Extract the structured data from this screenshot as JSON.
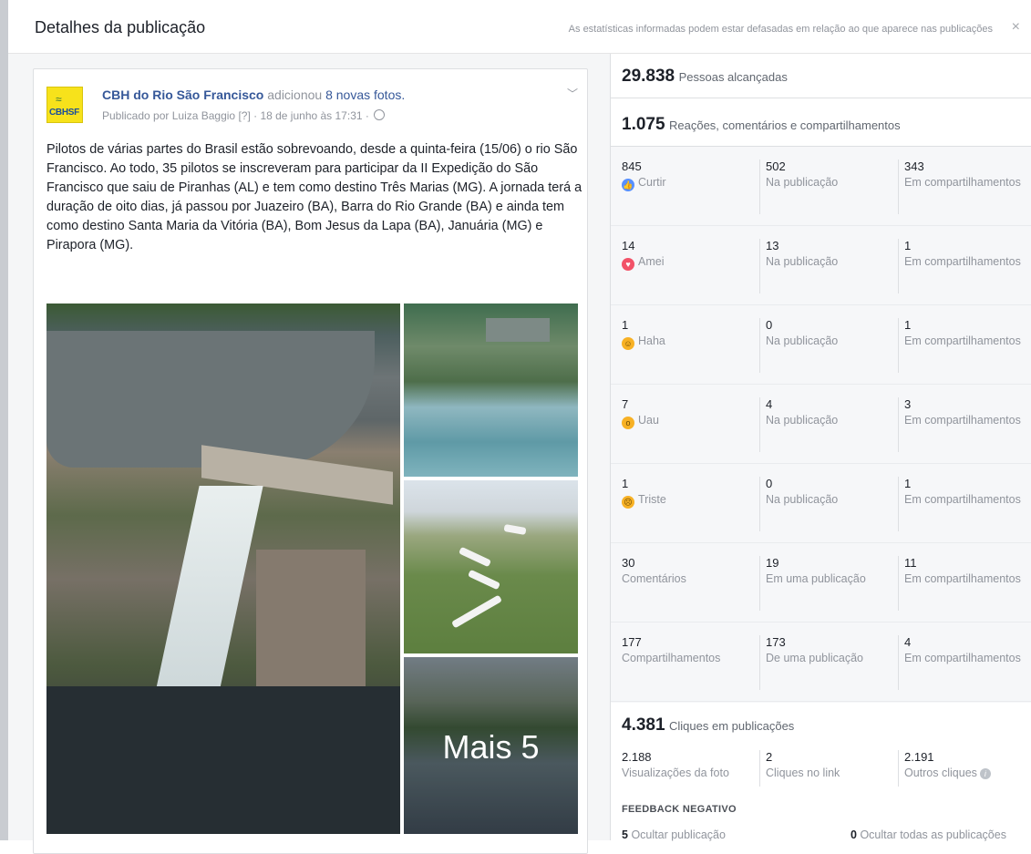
{
  "header": {
    "title": "Detalhes da publicação",
    "notice": "As estatísticas informadas podem estar defasadas em relação ao que aparece nas publicações",
    "close": "×"
  },
  "post": {
    "logo_text": "CBHSF",
    "page_name": "CBH do Rio São Francisco",
    "action": "adicionou",
    "new_photos": "8 novas fotos.",
    "meta": "Publicado por Luiza Baggio [?] · 18 de junho às 17:31 ·",
    "text": "Pilotos de várias partes do Brasil estão sobrevoando, desde a quinta-feira (15/06) o rio São Francisco. Ao todo, 35 pilotos se inscreveram para participar da II Expedição do São Francisco que saiu de Piranhas (AL) e tem como destino Três Marias (MG). A jornada terá a duração de oito dias, já passou por Juazeiro (BA), Barra do Rio Grande (BA) e ainda tem como destino Santa Maria da Vitória (BA), Bom Jesus da Lapa (BA), Januária (MG) e Pirapora (MG).",
    "more_photos": "Mais 5"
  },
  "stats": {
    "reach": {
      "value": "29.838",
      "label": "Pessoas alcançadas"
    },
    "engagement": {
      "value": "1.075",
      "label": "Reações, comentários e compartilhamentos"
    },
    "rows": [
      {
        "total": "845",
        "label": "Curtir",
        "icon": "like-icon",
        "on_post": "502",
        "on_post_label": "Na publicação",
        "shares": "343",
        "shares_label": "Em compartilhamentos"
      },
      {
        "total": "14",
        "label": "Amei",
        "icon": "love-icon",
        "on_post": "13",
        "on_post_label": "Na publicação",
        "shares": "1",
        "shares_label": "Em compartilhamentos"
      },
      {
        "total": "1",
        "label": "Haha",
        "icon": "haha-icon",
        "on_post": "0",
        "on_post_label": "Na publicação",
        "shares": "1",
        "shares_label": "Em compartilhamentos"
      },
      {
        "total": "7",
        "label": "Uau",
        "icon": "wow-icon",
        "on_post": "4",
        "on_post_label": "Na publicação",
        "shares": "3",
        "shares_label": "Em compartilhamentos"
      },
      {
        "total": "1",
        "label": "Triste",
        "icon": "sad-icon",
        "on_post": "0",
        "on_post_label": "Na publicação",
        "shares": "1",
        "shares_label": "Em compartilhamentos"
      },
      {
        "total": "30",
        "label": "Comentários",
        "icon": "",
        "on_post": "19",
        "on_post_label": "Em uma publicação",
        "shares": "11",
        "shares_label": "Em compartilhamentos"
      },
      {
        "total": "177",
        "label": "Compartilhamentos",
        "icon": "",
        "on_post": "173",
        "on_post_label": "De uma publicação",
        "shares": "4",
        "shares_label": "Em compartilhamentos"
      }
    ],
    "clicks": {
      "value": "4.381",
      "label": "Cliques em publicações",
      "photo_views": "2.188",
      "photo_views_label": "Visualizações da foto",
      "link_clicks": "2",
      "link_clicks_label": "Cliques no link",
      "other_clicks": "2.191",
      "other_clicks_label": "Outros cliques"
    },
    "negative_feedback": {
      "title": "FEEDBACK NEGATIVO",
      "hide_post_value": "5",
      "hide_post_label": "Ocultar publicação",
      "hide_all_value": "0",
      "hide_all_label": "Ocultar todas as publicações"
    }
  }
}
